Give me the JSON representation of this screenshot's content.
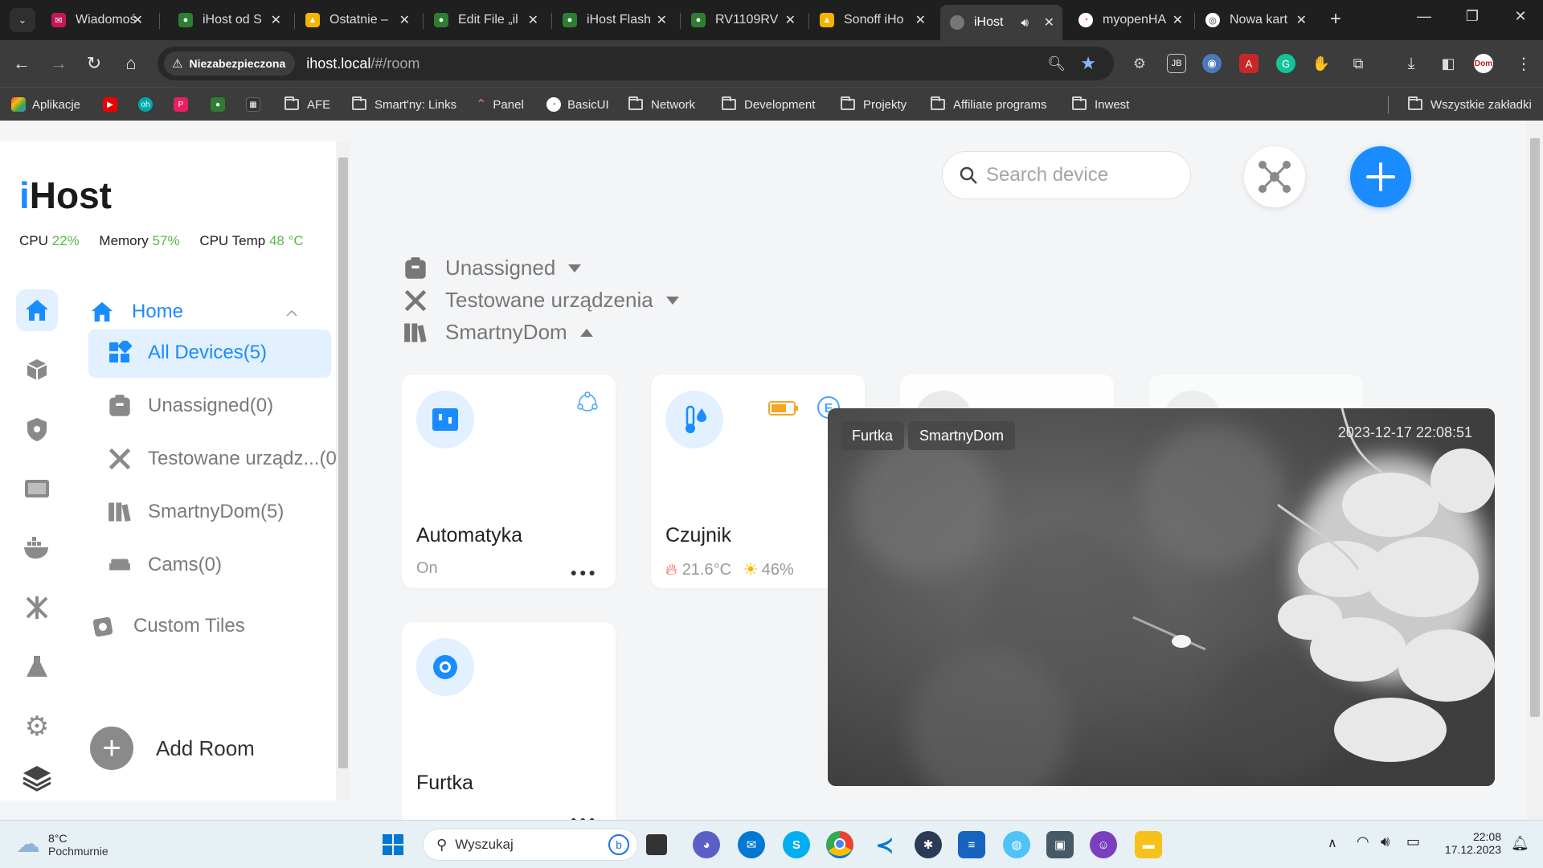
{
  "browser": {
    "tabs": [
      {
        "title": "Wiadomoś",
        "color": "#c2185b"
      },
      {
        "title": "iHost od S",
        "color": "#2e7d32"
      },
      {
        "title": "Ostatnie –",
        "color": "#f4b400"
      },
      {
        "title": "Edit File „il",
        "color": "#2e7d32"
      },
      {
        "title": "iHost Flash",
        "color": "#2e7d32"
      },
      {
        "title": "RV1109RV",
        "color": "#2e7d32"
      },
      {
        "title": "Sonoff iHo",
        "color": "#f4b400"
      },
      {
        "title": "iHost",
        "color": "#777777"
      },
      {
        "title": "myopenHA",
        "color": "#ffffff"
      },
      {
        "title": "Nowa kart",
        "color": "#ffffff"
      }
    ],
    "address": {
      "security_label": "Niezabezpieczona",
      "host": "ihost.local",
      "path": "/#/room"
    },
    "bookmarks": [
      "Aplikacje",
      "AFE",
      "Smart'ny: Links",
      "Panel",
      "BasicUI",
      "Network",
      "Development",
      "Projekty",
      "Affiliate programs",
      "Inwest"
    ],
    "all_bookmarks": "Wszystkie zakładki"
  },
  "app": {
    "logo_prefix": "i",
    "logo_rest": "Host",
    "stats": [
      {
        "label": "CPU",
        "value": "22%"
      },
      {
        "label": "Memory",
        "value": "57%"
      },
      {
        "label": "CPU Temp",
        "value": "48 °C"
      }
    ],
    "nav": {
      "home": "Home",
      "items": [
        {
          "label": "All Devices(5)",
          "icon": "grid-icon"
        },
        {
          "label": "Unassigned(0)",
          "icon": "box-icon"
        },
        {
          "label": "Testowane urządz...(0)",
          "icon": "tools-icon"
        },
        {
          "label": "SmartnyDom(5)",
          "icon": "books-icon"
        },
        {
          "label": "Cams(0)",
          "icon": "bed-icon"
        }
      ],
      "custom_tiles": "Custom Tiles",
      "add_room": "Add Room"
    },
    "search_placeholder": "Search device",
    "groups": [
      {
        "label": "Unassigned",
        "expanded": false
      },
      {
        "label": "Testowane urządzenia",
        "expanded": false
      },
      {
        "label": "SmartnyDom",
        "expanded": true
      }
    ],
    "devices": [
      {
        "name": "Automatyka",
        "status": "On"
      },
      {
        "name": "Czujnik",
        "temperature": "21.6°C",
        "humidity": "46%"
      },
      {
        "name": "Furtka"
      }
    ],
    "camera": {
      "chip1": "Furtka",
      "chip2": "SmartnyDom",
      "timestamp": "2023-12-17 22:08:51"
    }
  },
  "taskbar": {
    "weather_temp": "8°C",
    "weather_desc": "Pochmurnie",
    "search_placeholder": "Wyszukaj",
    "time": "22:08",
    "date": "17.12.2023"
  }
}
